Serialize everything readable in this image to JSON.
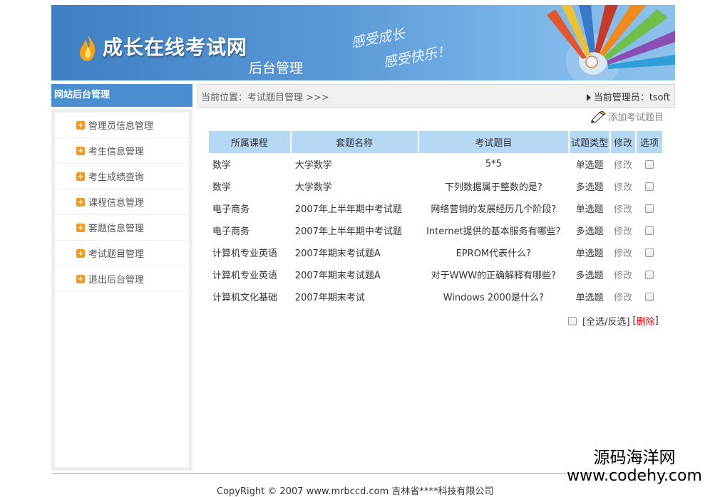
{
  "banner": {
    "site_title": "成长在线考试网",
    "sub_title": "后台管理",
    "slogan_line1": "感受成长",
    "slogan_line2": "感受快乐！"
  },
  "sidebar": {
    "header": "网站后台管理",
    "items": [
      {
        "label": "管理员信息管理"
      },
      {
        "label": "考生信息管理"
      },
      {
        "label": "考生成绩查询"
      },
      {
        "label": "课程信息管理"
      },
      {
        "label": "套题信息管理"
      },
      {
        "label": "考试题目管理"
      },
      {
        "label": "退出后台管理"
      }
    ]
  },
  "breadcrumb": {
    "text": "当前位置：考试题目管理 >>>",
    "admin_text": "当前管理员：tsoft"
  },
  "actions": {
    "add_label": "添加考试题目"
  },
  "table": {
    "headers": [
      "所属课程",
      "套题名称",
      "考试题目",
      "试题类型",
      "修改",
      "选项"
    ],
    "rows": [
      {
        "course": "数学",
        "set": "大学数学",
        "question": "5*5",
        "type": "单选题",
        "edit": "修改"
      },
      {
        "course": "数学",
        "set": "大学数学",
        "question": "下列数据属于整数的是?",
        "type": "多选题",
        "edit": "修改"
      },
      {
        "course": "电子商务",
        "set": "2007年上半年期中考试题",
        "question": "网络营销的发展经历几个阶段?",
        "type": "单选题",
        "edit": "修改"
      },
      {
        "course": "电子商务",
        "set": "2007年上半年期中考试题",
        "question": "Internet提供的基本服务有哪些?",
        "type": "多选题",
        "edit": "修改"
      },
      {
        "course": "计算机专业英语",
        "set": "2007年期末考试题A",
        "question": "EPROM代表什么?",
        "type": "单选题",
        "edit": "修改"
      },
      {
        "course": "计算机专业英语",
        "set": "2007年期末考试题A",
        "question": "对于WWW的正确解释有哪些?",
        "type": "多选题",
        "edit": "修改"
      },
      {
        "course": "计算机文化基础",
        "set": "2007年期末考试",
        "question": "Windows 2000是什么?",
        "type": "单选题",
        "edit": "修改"
      }
    ]
  },
  "bulk": {
    "select_label": "[全选/反选]",
    "bracket_open": "[",
    "delete_label": "删除",
    "bracket_close": "]"
  },
  "footer": {
    "copyright": "CopyRight © 2007 www.mrbccd.com 吉林省****科技有限公司"
  },
  "watermark": {
    "line1": "源码海洋网",
    "line2": "www.codehy.com"
  },
  "colors": {
    "banner_blue": "#4a8fd0",
    "header_cell": "#b7d8f4",
    "menu_plus": "#f39a1e",
    "delete_red": "#d40000"
  }
}
